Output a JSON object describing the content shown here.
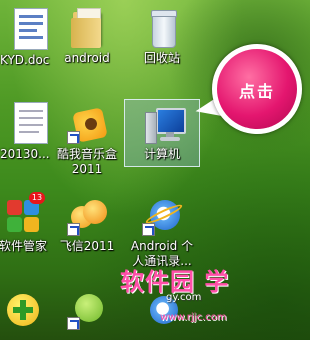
{
  "desktop": {
    "icons": [
      {
        "label": "KYD.doc",
        "icon": "word-doc-icon"
      },
      {
        "label": "android",
        "icon": "folder-icon"
      },
      {
        "label": "回收站",
        "icon": "recycle-bin-icon"
      },
      {
        "label": "20130...",
        "icon": "document-icon"
      },
      {
        "label": "酷我音乐盒",
        "label2": "2011",
        "icon": "kuwo-music-icon"
      },
      {
        "label": "计算机",
        "icon": "computer-icon",
        "selected": true
      },
      {
        "label": "软件管家",
        "icon": "software-manager-icon"
      },
      {
        "label": "飞信2011",
        "icon": "fetion-icon"
      },
      {
        "label": "Android 个",
        "label2": "人通讯录...",
        "icon": "ie-icon"
      }
    ]
  },
  "callout": {
    "text": "点击"
  },
  "watermark": {
    "logo": "软件园 学",
    "url": "gy.com",
    "url2": "www.rjjc.com"
  },
  "colors": {
    "callout": "#e4166f",
    "selection": "#96b9dc",
    "grass": "#4f9a25"
  }
}
